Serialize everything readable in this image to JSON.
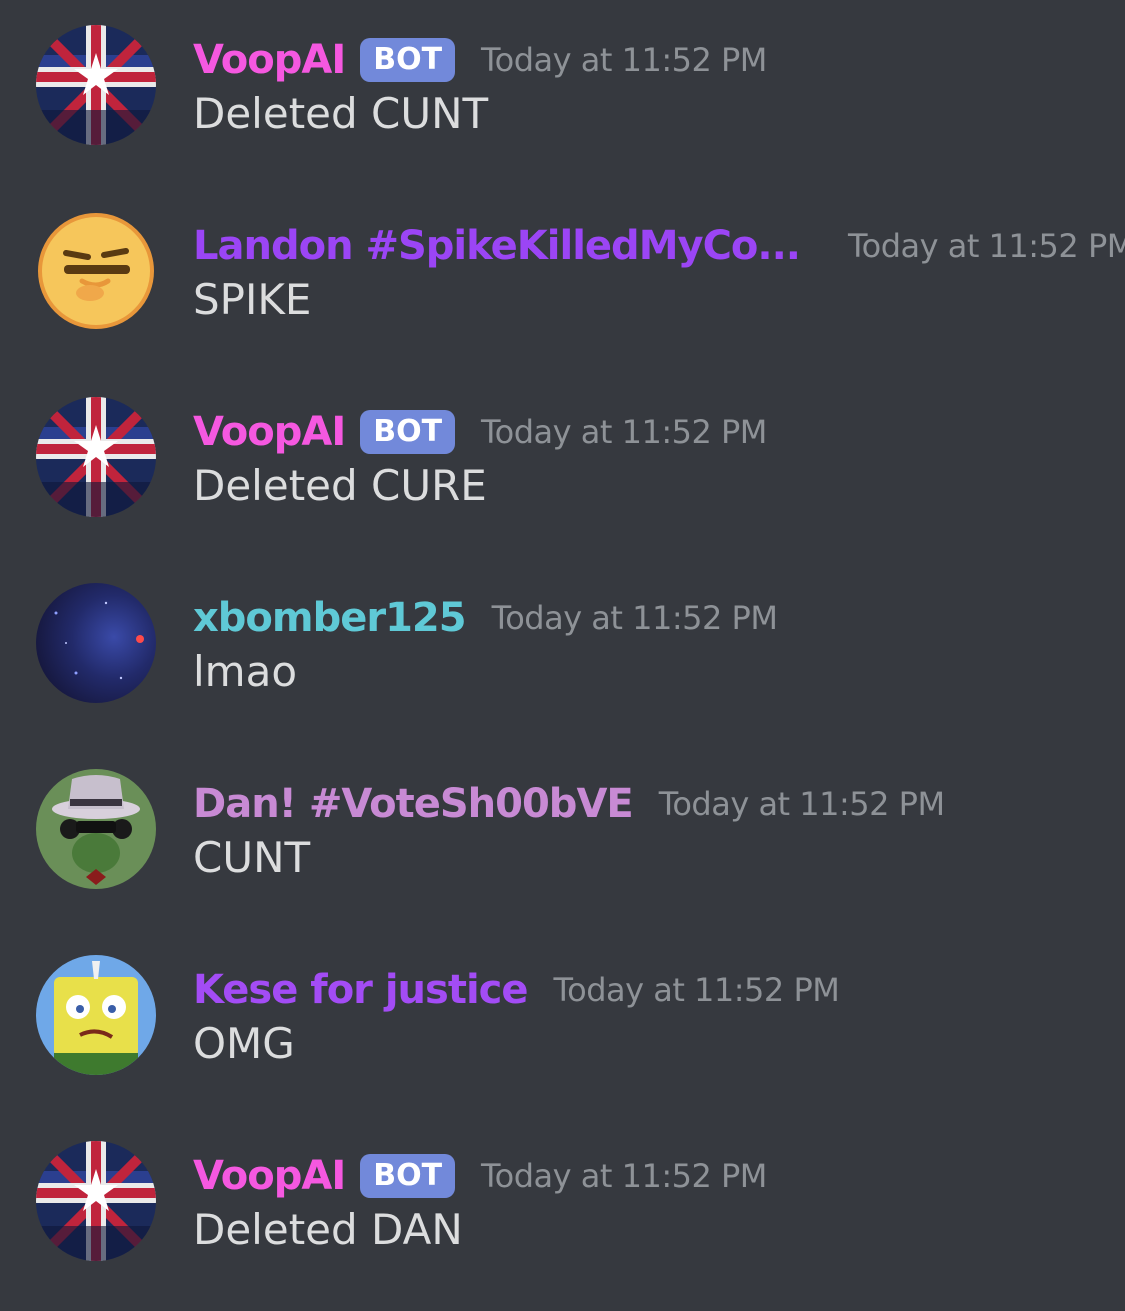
{
  "colors": {
    "background": "#36393f",
    "timestamp": "#8e9297",
    "message_text": "#dcddde",
    "bot_badge": "#7289da",
    "voopai": "#f558e0",
    "landon": "#9b45f5",
    "xbomber": "#5fc9d6",
    "dan": "#c88ad4",
    "kese": "#a34cf5"
  },
  "messages": [
    {
      "username": "VoopAI",
      "bot_label": "BOT",
      "timestamp": "Today at 11:52 PM",
      "content": "Deleted CUNT",
      "avatar_icon": "flag-avatar-icon",
      "name_color": "#f558e0"
    },
    {
      "username": "Landon #SpikeKilledMyCo...",
      "timestamp": "Today at 11:52 PM",
      "content": "SPIKE",
      "avatar_icon": "emoji-face-avatar-icon",
      "name_color": "#9b45f5"
    },
    {
      "username": "VoopAI",
      "bot_label": "BOT",
      "timestamp": "Today at 11:52 PM",
      "content": "Deleted CURE",
      "avatar_icon": "flag-avatar-icon",
      "name_color": "#f558e0"
    },
    {
      "username": "xbomber125",
      "timestamp": "Today at 11:52 PM",
      "content": "lmao",
      "avatar_icon": "space-avatar-icon",
      "name_color": "#5fc9d6"
    },
    {
      "username": "Dan! #VoteSh00bVE",
      "timestamp": "Today at 11:52 PM",
      "content": "CUNT",
      "avatar_icon": "hat-character-avatar-icon",
      "name_color": "#c88ad4"
    },
    {
      "username": "Kese for justice",
      "timestamp": "Today at 11:52 PM",
      "content": "OMG",
      "avatar_icon": "spongebob-avatar-icon",
      "name_color": "#a34cf5"
    },
    {
      "username": "VoopAI",
      "bot_label": "BOT",
      "timestamp": "Today at 11:52 PM",
      "content": "Deleted DAN",
      "avatar_icon": "flag-avatar-icon",
      "name_color": "#f558e0"
    }
  ]
}
